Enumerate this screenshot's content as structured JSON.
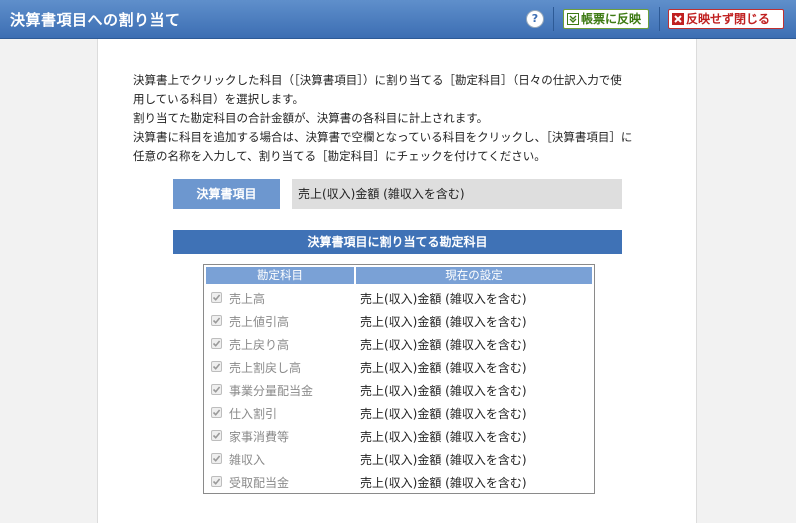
{
  "window": {
    "title": "決算書項目への割り当て",
    "help_label": "?",
    "apply_button": "帳票に反映",
    "close_button": "反映せず閉じる"
  },
  "description": [
    "決算書上でクリックした科目（［決算書項目］）に割り当てる［勘定科目］（日々の仕訳入力で使",
    "用している科目）を選択します。",
    "割り当てた勘定科目の合計金額が、決算書の各科目に計上されます。",
    "決算書に科目を追加する場合は、決算書で空欄となっている科目をクリックし、［決算書項目］に",
    "任意の名称を入力して、割り当てる［勘定科目］にチェックを付けてください。"
  ],
  "statement_item": {
    "label": "決算書項目",
    "value": "売上(収入)金額 (雑収入を含む)"
  },
  "section_title": "決算書項目に割り当てる勘定科目",
  "table": {
    "headers": [
      "勘定科目",
      "現在の設定"
    ],
    "rows": [
      {
        "account": "売上高",
        "current": "売上(収入)金額 (雑収入を含む)",
        "checked": true
      },
      {
        "account": "売上値引高",
        "current": "売上(収入)金額 (雑収入を含む)",
        "checked": true
      },
      {
        "account": "売上戻り高",
        "current": "売上(収入)金額 (雑収入を含む)",
        "checked": true
      },
      {
        "account": "売上割戻し高",
        "current": "売上(収入)金額 (雑収入を含む)",
        "checked": true
      },
      {
        "account": "事業分量配当金",
        "current": "売上(収入)金額 (雑収入を含む)",
        "checked": true
      },
      {
        "account": "仕入割引",
        "current": "売上(収入)金額 (雑収入を含む)",
        "checked": true
      },
      {
        "account": "家事消費等",
        "current": "売上(収入)金額 (雑収入を含む)",
        "checked": true
      },
      {
        "account": "雑収入",
        "current": "売上(収入)金額 (雑収入を含む)",
        "checked": true
      },
      {
        "account": "受取配当金",
        "current": "売上(収入)金額 (雑収入を含む)",
        "checked": true
      }
    ]
  },
  "colors": {
    "titlebar": "#3c6eb3",
    "label_bg": "#6d97cf",
    "section_bg": "#3f72b6",
    "header_bg": "#7aa1d6",
    "apply_green": "#3d7a13",
    "close_red": "#c02020"
  }
}
